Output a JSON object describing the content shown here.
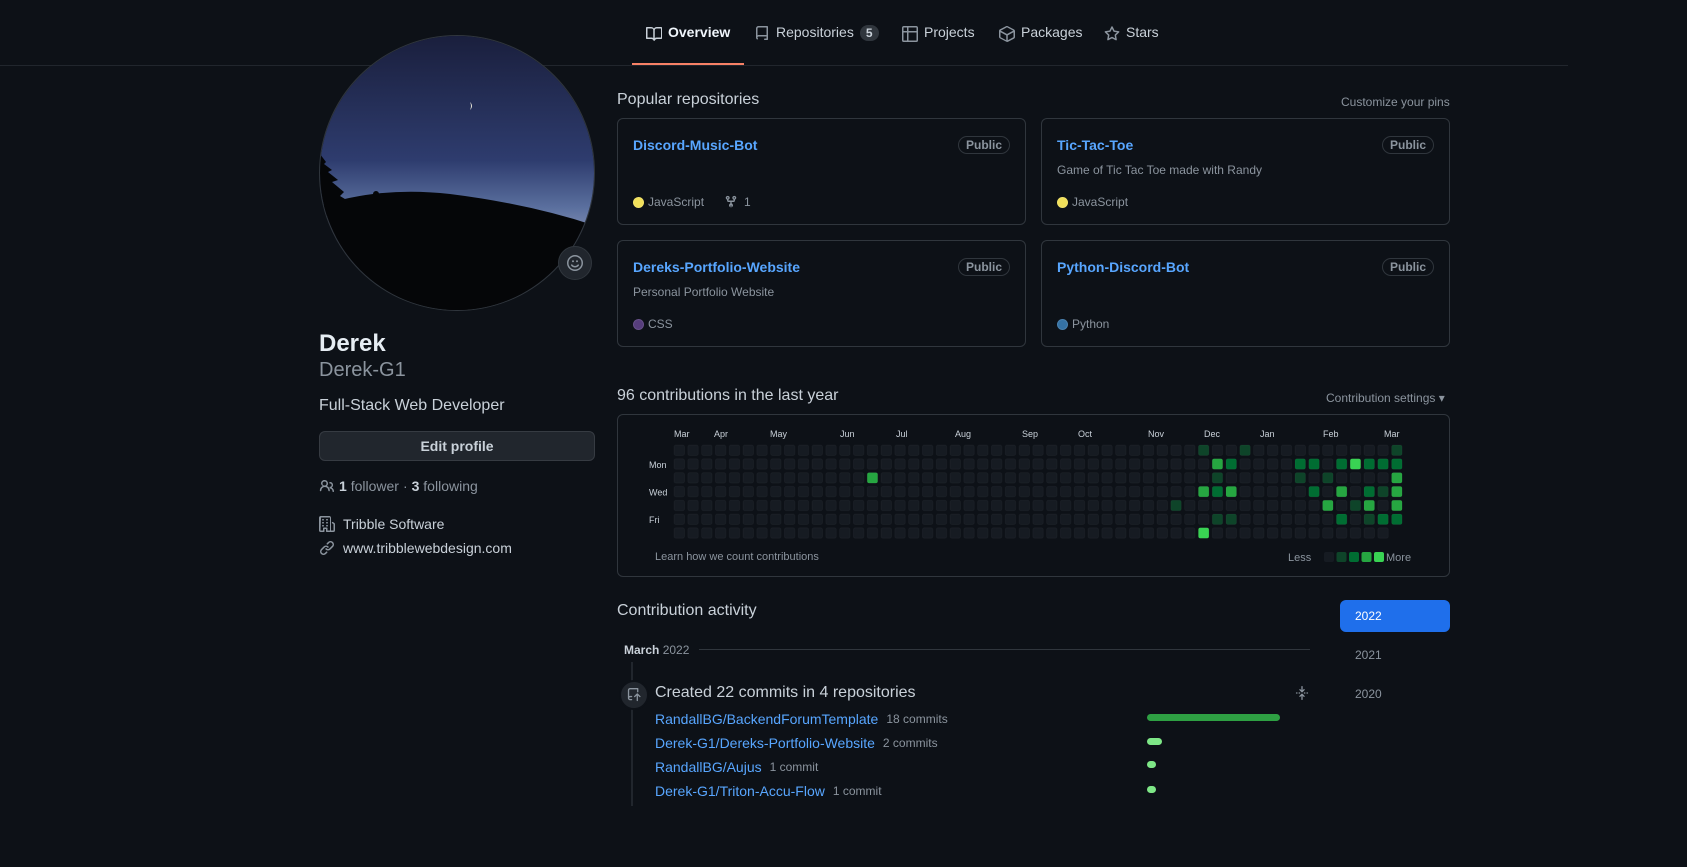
{
  "tabs": [
    {
      "label": "Overview",
      "icon": "book-icon",
      "active": true
    },
    {
      "label": "Repositories",
      "icon": "repo-icon",
      "count": "5"
    },
    {
      "label": "Projects",
      "icon": "table-icon"
    },
    {
      "label": "Packages",
      "icon": "package-icon"
    },
    {
      "label": "Stars",
      "icon": "star-icon"
    }
  ],
  "profile": {
    "name": "Derek",
    "login": "Derek-G1",
    "bio": "Full-Stack Web Developer",
    "edit_label": "Edit profile",
    "followers": "1",
    "followers_label": "follower",
    "separator": "·",
    "following": "3",
    "following_label": "following",
    "company": "Tribble Software",
    "website": "www.tribblewebdesign.com"
  },
  "popular": {
    "title": "Popular repositories",
    "customize": "Customize your pins",
    "repos": [
      {
        "name": "Discord-Music-Bot",
        "visibility": "Public",
        "description": "",
        "language": "JavaScript",
        "lang_color": "#f1e05a",
        "forks": "1"
      },
      {
        "name": "Tic-Tac-Toe",
        "visibility": "Public",
        "description": "Game of Tic Tac Toe made with Randy",
        "language": "JavaScript",
        "lang_color": "#f1e05a",
        "forks": ""
      },
      {
        "name": "Dereks-Portfolio-Website",
        "visibility": "Public",
        "description": "Personal Portfolio Website",
        "language": "CSS",
        "lang_color": "#563d7c",
        "forks": ""
      },
      {
        "name": "Python-Discord-Bot",
        "visibility": "Public",
        "description": "",
        "language": "Python",
        "lang_color": "#3572A5",
        "forks": ""
      }
    ]
  },
  "contributions": {
    "title": "96 contributions in the last year",
    "settings": "Contribution settings",
    "months": [
      "Mar",
      "Apr",
      "May",
      "Jun",
      "Jul",
      "Aug",
      "Sep",
      "Oct",
      "Nov",
      "Dec",
      "Jan",
      "Feb",
      "Mar"
    ],
    "days": [
      "Mon",
      "Wed",
      "Fri"
    ],
    "learn": "Learn how we count contributions",
    "less": "Less",
    "more": "More",
    "level_colors": [
      "#161b22",
      "#0e4429",
      "#006d32",
      "#26a641",
      "#39d353"
    ]
  },
  "activity": {
    "title": "Contribution activity",
    "years": [
      "2022",
      "2021",
      "2020"
    ],
    "month": "March",
    "month_year": "2022",
    "summary": "Created 22 commits in 4 repositories",
    "rows": [
      {
        "repo": "RandallBG/BackendForumTemplate",
        "count": "18 commits",
        "value": 18
      },
      {
        "repo": "Derek-G1/Dereks-Portfolio-Website",
        "count": "2 commits",
        "value": 2
      },
      {
        "repo": "RandallBG/Aujus",
        "count": "1 commit",
        "value": 1
      },
      {
        "repo": "Derek-G1/Triton-Accu-Flow",
        "count": "1 commit",
        "value": 1
      }
    ],
    "bar_colors": [
      "#2ea043",
      "#7ee787"
    ]
  }
}
